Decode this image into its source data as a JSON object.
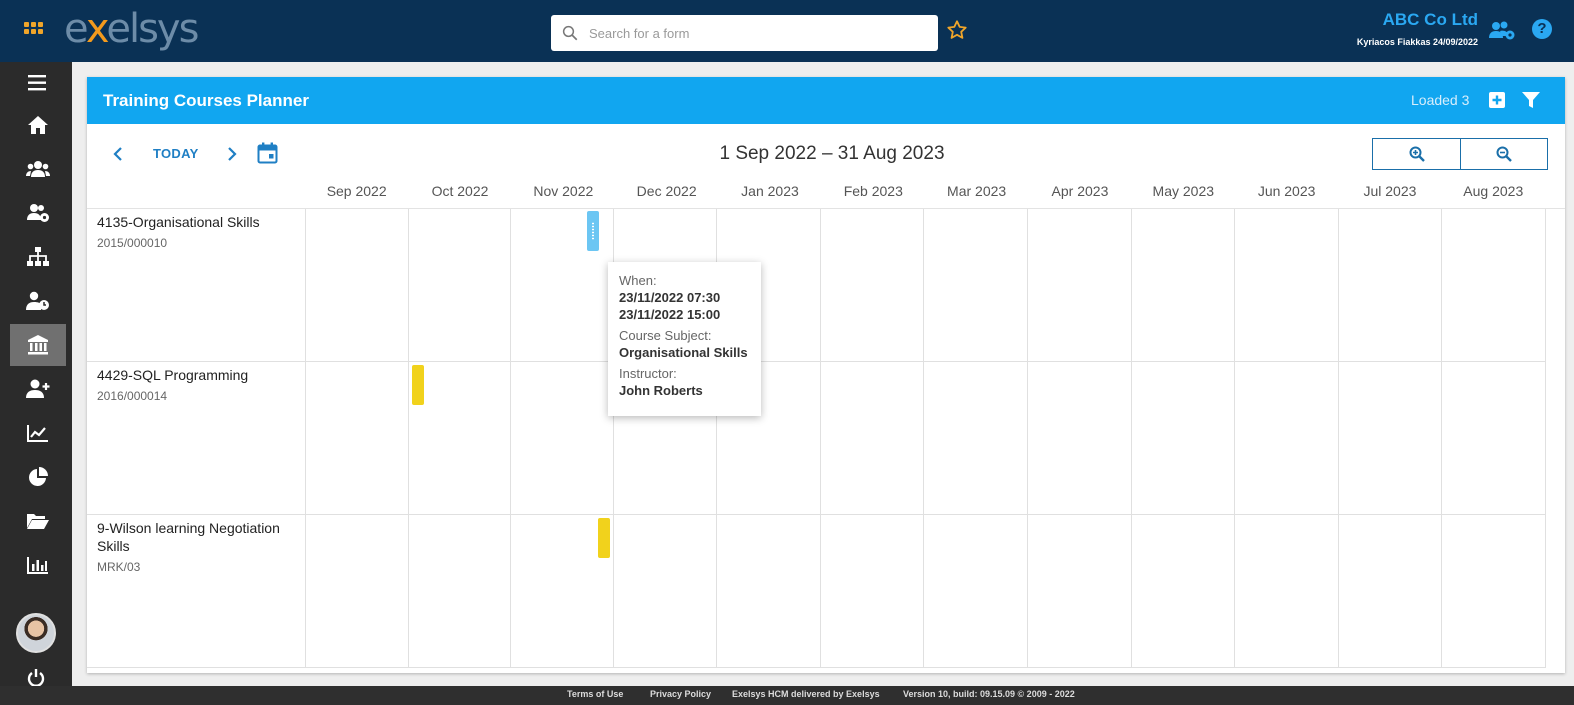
{
  "header": {
    "logo_prefix": "e",
    "logo_x": "x",
    "logo_suffix": "elsys",
    "search_placeholder": "Search for a form",
    "company": "ABC Co Ltd",
    "user_line": "Kyriacos Fiakkas 24/09/2022",
    "help_label": "?"
  },
  "sidebar": {
    "items": [
      {
        "icon": "menu-icon"
      },
      {
        "icon": "home-icon"
      },
      {
        "icon": "people-icon"
      },
      {
        "icon": "people-settings-icon"
      },
      {
        "icon": "org-chart-icon"
      },
      {
        "icon": "person-clock-icon"
      },
      {
        "icon": "institution-icon",
        "active": true
      },
      {
        "icon": "add-person-icon"
      },
      {
        "icon": "trend-chart-icon"
      },
      {
        "icon": "pie-chart-icon"
      },
      {
        "icon": "folder-open-icon"
      },
      {
        "icon": "bar-chart-icon"
      }
    ]
  },
  "planner": {
    "title": "Training Courses Planner",
    "loaded": "Loaded 3",
    "today": "TODAY",
    "range": "1 Sep 2022 – 31 Aug 2023",
    "months": [
      "Sep 2022",
      "Oct 2022",
      "Nov 2022",
      "Dec 2022",
      "Jan 2023",
      "Feb 2023",
      "Mar 2023",
      "Apr 2023",
      "May 2023",
      "Jun 2023",
      "Jul 2023",
      "Aug 2023"
    ],
    "rows": [
      {
        "title": "4135-Organisational Skills",
        "code": "2015/000010",
        "event_date": "23/11/2022",
        "event_color": "#6cc6f3"
      },
      {
        "title": "4429-SQL Programming",
        "code": "2016/000014",
        "event_date": "Oct 2022",
        "event_color": "#f1d21c"
      },
      {
        "title": "9-Wilson learning Negotiation Skills",
        "code": "MRK/03",
        "event_date": "Nov 2022",
        "event_color": "#f1d21c"
      }
    ],
    "tooltip": {
      "when_label": "When:",
      "start": "23/11/2022 07:30",
      "end": "23/11/2022 15:00",
      "subject_label": "Course Subject:",
      "subject": "Organisational Skills",
      "instructor_label": "Instructor:",
      "instructor": "John Roberts"
    }
  },
  "footer": {
    "terms": "Terms of Use",
    "privacy": "Privacy Policy",
    "delivered": "Exelsys HCM delivered by Exelsys",
    "version": "Version 10, build: 09.15.09 © 2009 - 2022"
  },
  "colors": {
    "topbar": "#0a3155",
    "accent": "#11a6f0",
    "sidebar": "#2b2b2b",
    "event_yellow": "#f1d21c",
    "event_blue": "#6cc6f3"
  }
}
